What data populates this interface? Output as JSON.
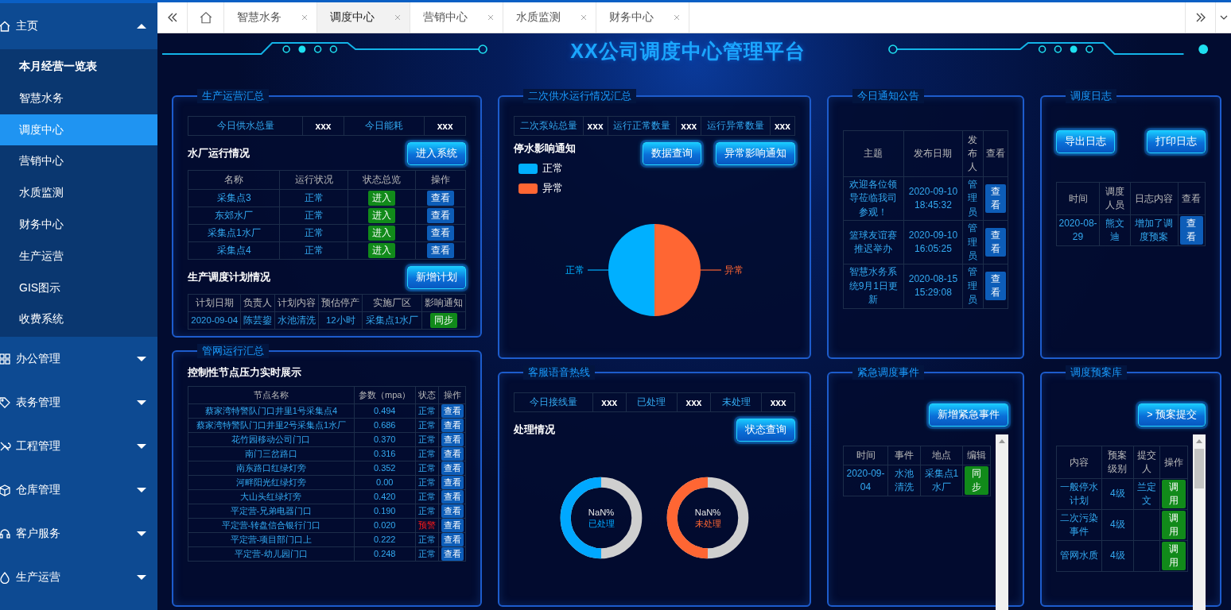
{
  "sidebar": {
    "items": [
      {
        "label": "主页",
        "expanded": true,
        "children": [
          {
            "label": "本月经营一览表",
            "selected": false
          },
          {
            "label": "智慧水务",
            "selected": false
          },
          {
            "label": "调度中心",
            "selected": true
          },
          {
            "label": "营销中心",
            "selected": false
          },
          {
            "label": "水质监测",
            "selected": false
          },
          {
            "label": "财务中心",
            "selected": false
          },
          {
            "label": "生产运营",
            "selected": false
          },
          {
            "label": "GIS图示",
            "selected": false
          },
          {
            "label": "收费系统",
            "selected": false
          }
        ]
      },
      {
        "label": "办公管理",
        "expanded": false
      },
      {
        "label": "表务管理",
        "expanded": false
      },
      {
        "label": "工程管理",
        "expanded": false
      },
      {
        "label": "仓库管理",
        "expanded": false
      },
      {
        "label": "客户服务",
        "expanded": false
      },
      {
        "label": "生产运营",
        "expanded": false
      }
    ]
  },
  "tabs": [
    {
      "label": "智慧水务",
      "selected": false
    },
    {
      "label": "调度中心",
      "selected": true
    },
    {
      "label": "营销中心",
      "selected": false
    },
    {
      "label": "水质监测",
      "selected": false
    },
    {
      "label": "财务中心",
      "selected": false
    }
  ],
  "title": "XX公司调度中心管理平台",
  "production": {
    "title": "生产运营汇总",
    "summary": [
      {
        "label": "今日供水总量",
        "value": "xxx"
      },
      {
        "label": "今日能耗",
        "value": "xxx"
      }
    ],
    "plant_heading": "水厂运行情况",
    "plant_button": "进入系统",
    "plant_table": {
      "columns": [
        "名称",
        "运行状况",
        "状态总览",
        "操作"
      ],
      "rows": [
        {
          "cells": [
            {
              "kind": "text",
              "text": "采集点3"
            },
            {
              "kind": "text",
              "text": "正常"
            },
            {
              "kind": "enter",
              "text": "进入"
            },
            {
              "kind": "view",
              "text": "查看"
            }
          ]
        },
        {
          "cells": [
            {
              "kind": "text",
              "text": "东郊水厂"
            },
            {
              "kind": "text",
              "text": "正常"
            },
            {
              "kind": "enter",
              "text": "进入"
            },
            {
              "kind": "view",
              "text": "查看"
            }
          ]
        },
        {
          "cells": [
            {
              "kind": "text",
              "text": "采集点1水厂"
            },
            {
              "kind": "text",
              "text": "正常"
            },
            {
              "kind": "enter",
              "text": "进入"
            },
            {
              "kind": "view",
              "text": "查看"
            }
          ]
        },
        {
          "cells": [
            {
              "kind": "text",
              "text": "采集点4"
            },
            {
              "kind": "text",
              "text": "正常"
            },
            {
              "kind": "enter",
              "text": "进入"
            },
            {
              "kind": "view",
              "text": "查看"
            }
          ]
        }
      ]
    },
    "plan_heading": "生产调度计划情况",
    "plan_button": "新增计划",
    "plan_table": {
      "columns": [
        "计划日期",
        "负责人",
        "计划内容",
        "预估停产",
        "实施厂区",
        "影响通知"
      ],
      "rows": [
        {
          "cells": [
            {
              "kind": "text",
              "text": "2020-09-04"
            },
            {
              "kind": "text",
              "text": "陈芸鋆"
            },
            {
              "kind": "text",
              "text": "水池清洗"
            },
            {
              "kind": "text",
              "text": "12小时"
            },
            {
              "kind": "text",
              "text": "采集点1水厂"
            },
            {
              "kind": "sync",
              "text": "同步"
            }
          ]
        }
      ]
    }
  },
  "pipe": {
    "title": "管网运行汇总",
    "heading": "控制性节点压力实时展示",
    "table": {
      "columns": [
        "节点名称",
        "参数（mpa）",
        "状态",
        "操作"
      ],
      "rows": [
        {
          "cells": [
            {
              "kind": "text",
              "text": "蔡家湾特警队门口井里1号采集点4"
            },
            {
              "kind": "text",
              "text": "0.494"
            },
            {
              "kind": "status",
              "text": "正常",
              "warning": false
            },
            {
              "kind": "view",
              "text": "查看"
            }
          ]
        },
        {
          "cells": [
            {
              "kind": "text",
              "text": "蔡家湾特警队门口井里2号采集点1水厂"
            },
            {
              "kind": "text",
              "text": "0.686"
            },
            {
              "kind": "status",
              "text": "正常",
              "warning": false
            },
            {
              "kind": "view",
              "text": "查看"
            }
          ]
        },
        {
          "cells": [
            {
              "kind": "text",
              "text": "花竹园移动公司门口"
            },
            {
              "kind": "text",
              "text": "0.370"
            },
            {
              "kind": "status",
              "text": "正常",
              "warning": false
            },
            {
              "kind": "view",
              "text": "查看"
            }
          ]
        },
        {
          "cells": [
            {
              "kind": "text",
              "text": "南门三岔路口"
            },
            {
              "kind": "text",
              "text": "0.316"
            },
            {
              "kind": "status",
              "text": "正常",
              "warning": false
            },
            {
              "kind": "view",
              "text": "查看"
            }
          ]
        },
        {
          "cells": [
            {
              "kind": "text",
              "text": "南东路口红绿灯旁"
            },
            {
              "kind": "text",
              "text": "0.352"
            },
            {
              "kind": "status",
              "text": "正常",
              "warning": false
            },
            {
              "kind": "view",
              "text": "查看"
            }
          ]
        },
        {
          "cells": [
            {
              "kind": "text",
              "text": "河畔阳光红绿灯旁"
            },
            {
              "kind": "text",
              "text": "0.00"
            },
            {
              "kind": "status",
              "text": "正常",
              "warning": false
            },
            {
              "kind": "view",
              "text": "查看"
            }
          ]
        },
        {
          "cells": [
            {
              "kind": "text",
              "text": "大山头红绿灯旁"
            },
            {
              "kind": "text",
              "text": "0.420"
            },
            {
              "kind": "status",
              "text": "正常",
              "warning": false
            },
            {
              "kind": "view",
              "text": "查看"
            }
          ]
        },
        {
          "cells": [
            {
              "kind": "text",
              "text": "平定营-兄弟电器门口"
            },
            {
              "kind": "text",
              "text": "0.190"
            },
            {
              "kind": "status",
              "text": "正常",
              "warning": false
            },
            {
              "kind": "view",
              "text": "查看"
            }
          ]
        },
        {
          "cells": [
            {
              "kind": "text",
              "text": "平定营-转盘信合银行门口"
            },
            {
              "kind": "text",
              "text": "0.020"
            },
            {
              "kind": "status",
              "text": "预警",
              "warning": true
            },
            {
              "kind": "view",
              "text": "查看"
            }
          ]
        },
        {
          "cells": [
            {
              "kind": "text",
              "text": "平定营-项目部门口上"
            },
            {
              "kind": "text",
              "text": "0.222"
            },
            {
              "kind": "status",
              "text": "正常",
              "warning": false
            },
            {
              "kind": "view",
              "text": "查看"
            }
          ]
        },
        {
          "cells": [
            {
              "kind": "text",
              "text": "平定营-幼儿园门口"
            },
            {
              "kind": "text",
              "text": "0.248"
            },
            {
              "kind": "status",
              "text": "正常",
              "warning": false
            },
            {
              "kind": "view",
              "text": "查看"
            }
          ]
        }
      ]
    }
  },
  "secondary": {
    "title": "二次供水运行情况汇总",
    "summary": [
      {
        "label": "二次泵站总量",
        "value": "xxx"
      },
      {
        "label": "运行正常数量",
        "value": "xxx"
      },
      {
        "label": "运行异常数量",
        "value": "xxx"
      }
    ],
    "heading": "停水影响通知",
    "buttons": [
      "数据查询",
      "异常影响通知"
    ],
    "legend": [
      {
        "label": "正常",
        "color": "#00b0ff"
      },
      {
        "label": "异常",
        "color": "#ff6633"
      }
    ],
    "chart_data": {
      "type": "pie",
      "categories": [
        "正常",
        "异常"
      ],
      "values": [
        50,
        50
      ]
    }
  },
  "hotline": {
    "title": "客服语音热线",
    "summary": [
      {
        "label": "今日接线量",
        "value": "xxx"
      },
      {
        "label": "已处理",
        "value": "xxx"
      },
      {
        "label": "未处理",
        "value": "xxx"
      }
    ],
    "heading": "处理情况",
    "button": "状态查询",
    "donuts": [
      {
        "value": "NaN%",
        "label": "已处理",
        "color": "#00a8ff"
      },
      {
        "value": "NaN%",
        "label": "未处理",
        "color": "#ff6633"
      }
    ]
  },
  "notices": {
    "title": "今日通知公告",
    "table": {
      "columns": [
        "主题",
        "发布日期",
        "发布人",
        "查看"
      ],
      "rows": [
        {
          "cells": [
            {
              "kind": "text",
              "text": "欢迎各位领导莅临我司参观！"
            },
            {
              "kind": "text",
              "text": "2020-09-10 18:45:32"
            },
            {
              "kind": "text",
              "text": "管理员"
            },
            {
              "kind": "view",
              "text": "查看"
            }
          ]
        },
        {
          "cells": [
            {
              "kind": "text",
              "text": "篮球友谊赛推迟举办"
            },
            {
              "kind": "text",
              "text": "2020-09-10 16:05:25"
            },
            {
              "kind": "text",
              "text": "管理员"
            },
            {
              "kind": "view",
              "text": "查看"
            }
          ]
        },
        {
          "cells": [
            {
              "kind": "text",
              "text": "智慧水务系统9月1日更新"
            },
            {
              "kind": "text",
              "text": "2020-08-15 15:29:08"
            },
            {
              "kind": "text",
              "text": "管理员"
            },
            {
              "kind": "view",
              "text": "查看"
            }
          ]
        }
      ]
    }
  },
  "log": {
    "title": "调度日志",
    "buttons": [
      "导出日志",
      "打印日志"
    ],
    "table": {
      "columns": [
        "时间",
        "调度人员",
        "日志内容",
        "查看"
      ],
      "rows": [
        {
          "cells": [
            {
              "kind": "text",
              "text": "2020-08-29"
            },
            {
              "kind": "text",
              "text": "熊文迪"
            },
            {
              "kind": "text",
              "text": "增加了调度预案"
            },
            {
              "kind": "view",
              "text": "查看"
            }
          ]
        }
      ]
    }
  },
  "emergency": {
    "title": "紧急调度事件",
    "button": "新增紧急事件",
    "table": {
      "columns": [
        "时间",
        "事件",
        "地点",
        "编辑"
      ],
      "rows": [
        {
          "cells": [
            {
              "kind": "text",
              "text": "2020-09-04"
            },
            {
              "kind": "text",
              "text": "水池清洗"
            },
            {
              "kind": "text",
              "text": "采集点1水厂"
            },
            {
              "kind": "sync",
              "text": "同步"
            }
          ]
        }
      ]
    }
  },
  "plans": {
    "title": "调度预案库",
    "button": "> 预案提交",
    "table": {
      "columns": [
        "内容",
        "预案级别",
        "提交人",
        "操作"
      ],
      "rows": [
        {
          "cells": [
            {
              "kind": "text",
              "text": "一般停水计划"
            },
            {
              "kind": "text",
              "text": "4级"
            },
            {
              "kind": "text",
              "text": "兰定文"
            },
            {
              "kind": "apply",
              "text": "调用"
            }
          ]
        },
        {
          "cells": [
            {
              "kind": "text",
              "text": "二次污染事件"
            },
            {
              "kind": "text",
              "text": "4级"
            },
            {
              "kind": "text",
              "text": ""
            },
            {
              "kind": "apply",
              "text": "调用"
            }
          ]
        },
        {
          "cells": [
            {
              "kind": "text",
              "text": "管网水质"
            },
            {
              "kind": "text",
              "text": "4级"
            },
            {
              "kind": "text",
              "text": ""
            },
            {
              "kind": "apply",
              "text": "调用"
            }
          ]
        }
      ]
    }
  }
}
